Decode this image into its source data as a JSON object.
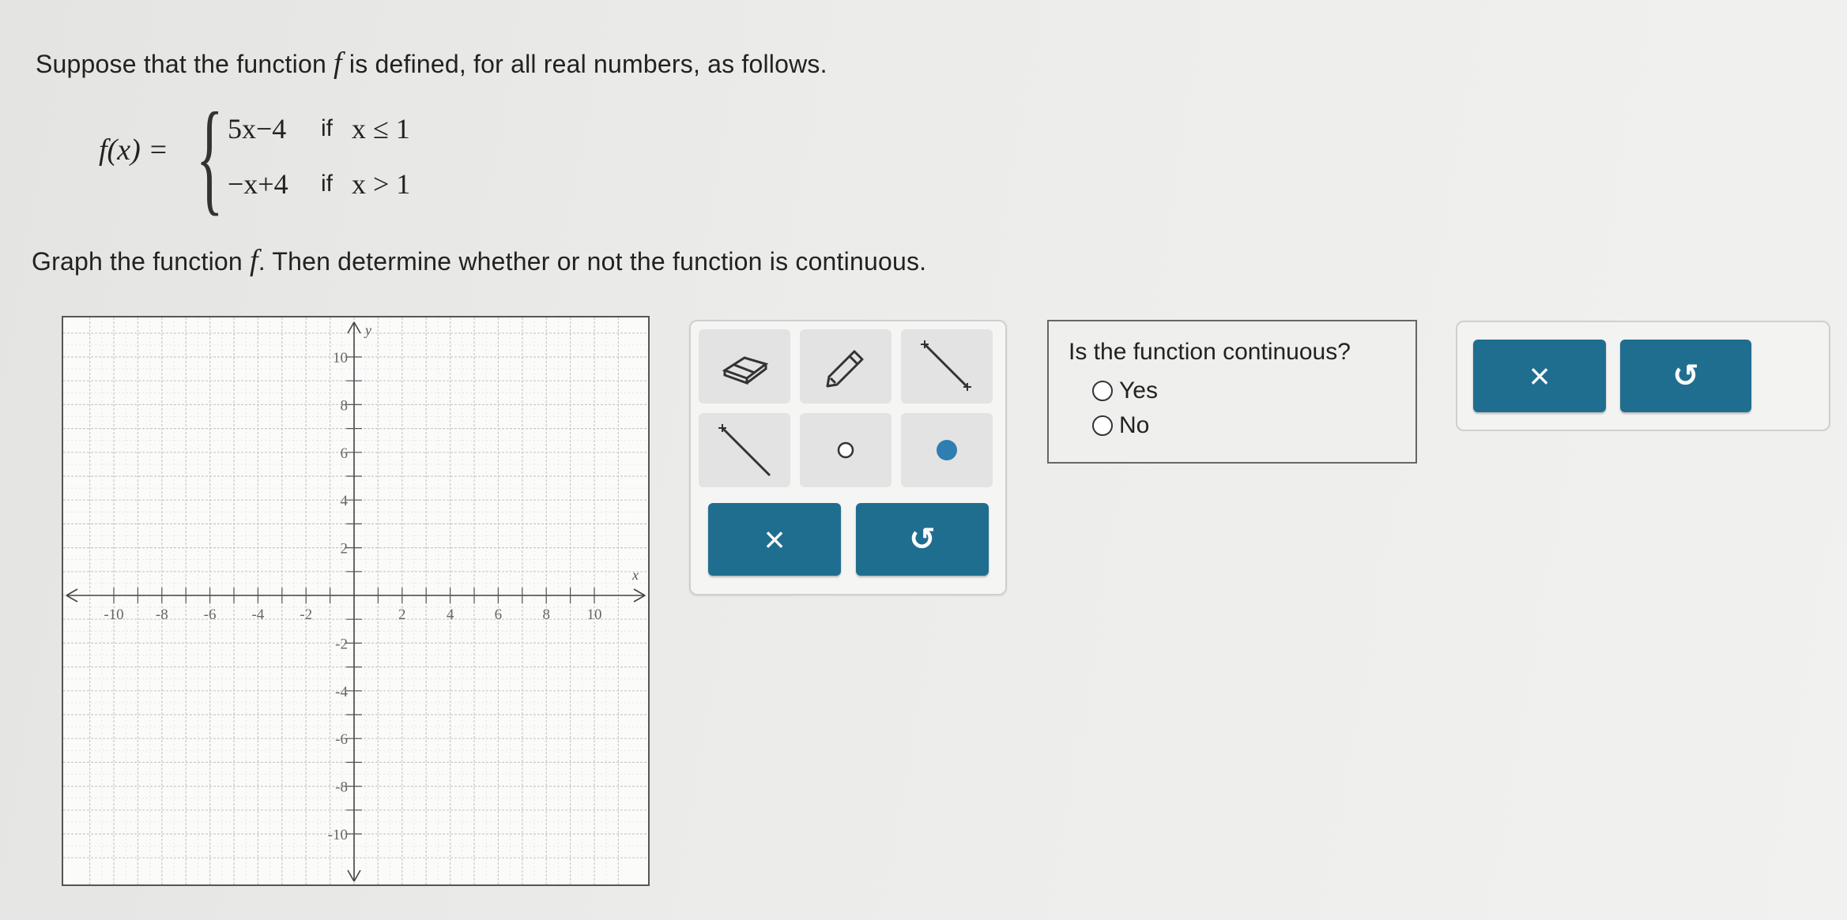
{
  "intro": {
    "before": "Suppose that the function ",
    "fname": "f",
    "after": " is defined, for all real numbers, as follows."
  },
  "piecewise": {
    "lhs": "f(x) =",
    "cases": [
      {
        "expr": "5x−4",
        "if": "if",
        "cond": "x ≤ 1"
      },
      {
        "expr": "−x+4",
        "if": "if",
        "cond": "x > 1"
      }
    ]
  },
  "instruction": {
    "before": "Graph the function ",
    "fname": "f",
    "after": ". Then determine whether or not the function is continuous."
  },
  "graph": {
    "x_axis_label": "x",
    "y_axis_label": "y",
    "x_range": [
      -11,
      11
    ],
    "y_range": [
      -11,
      11
    ],
    "x_tick_labels": [
      "-10",
      "-8",
      "-6",
      "-4",
      "-2",
      "2",
      "4",
      "6",
      "8",
      "10"
    ],
    "y_tick_labels": [
      "10",
      "8",
      "6",
      "4",
      "2",
      "-2",
      "-4",
      "-6",
      "-8",
      "-10"
    ],
    "grid": true
  },
  "toolbox": {
    "tools": [
      "eraser-icon",
      "pencil-icon",
      "segment-icon",
      "ray-icon",
      "open-point-icon",
      "closed-point-icon"
    ],
    "clear_symbol": "×",
    "undo_symbol": "↺"
  },
  "question": {
    "text": "Is the function continuous?",
    "options": [
      "Yes",
      "No"
    ]
  },
  "answer_panel": {
    "clear_symbol": "×",
    "undo_symbol": "↺"
  },
  "colors": {
    "button": "#1f6e8f",
    "point": "#2e7fb0"
  }
}
